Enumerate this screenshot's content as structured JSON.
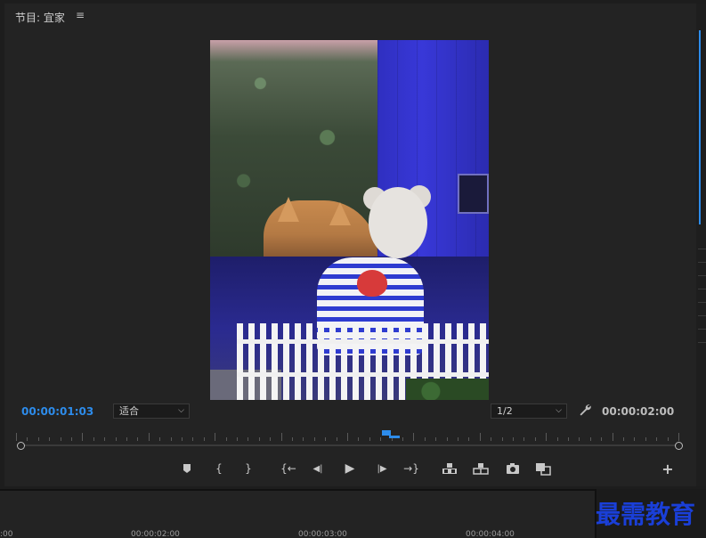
{
  "panel": {
    "title": "节目: 宜家",
    "menu_glyph": "≡"
  },
  "monitor": {
    "current_timecode": "00:00:01:03",
    "duration_timecode": "00:00:02:00",
    "zoom_select": "适合",
    "resolution_select": "1/2"
  },
  "controls": {
    "add_marker_icon": "marker-icon",
    "mark_in_glyph": "{",
    "mark_out_glyph": "}",
    "go_to_in_glyph": "{←",
    "step_back_glyph": "◀|",
    "play_glyph": "▶",
    "step_forward_glyph": "|▶",
    "go_to_out_glyph": "→}",
    "add_glyph": "+"
  },
  "timeline": {
    "labels": [
      ":00",
      "00:00:02:00",
      "00:00:03:00",
      "00:00:04:00"
    ]
  },
  "watermark": {
    "text": "最需教育"
  },
  "colors": {
    "accent": "#2d8ceb",
    "panel_bg": "#232323",
    "watermark": "#1a3fd8"
  }
}
